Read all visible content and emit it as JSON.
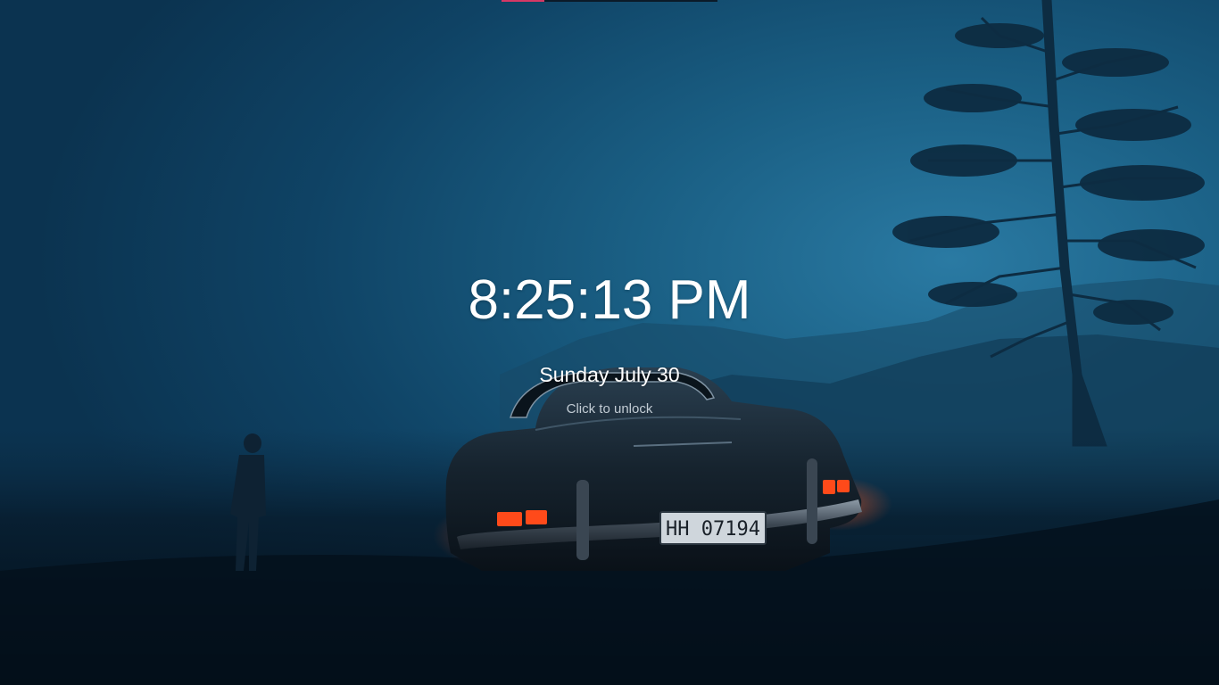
{
  "lockscreen": {
    "time": "8:25:13 PM",
    "date": "Sunday July 30",
    "unlock_hint": "Click to unlock"
  },
  "wallpaper": {
    "plate_text": "HH 07194",
    "sky_color": "#1e6a8f",
    "ground_color": "#030c15",
    "taillight_color": "#ff4a1a"
  },
  "topbar": {
    "accent_color": "#d63865"
  }
}
